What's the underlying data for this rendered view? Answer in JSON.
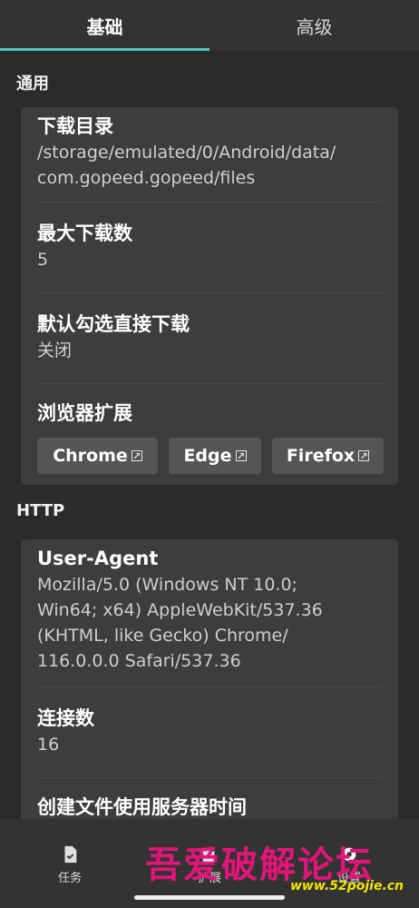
{
  "tabs": [
    {
      "label": "基础",
      "active": true
    },
    {
      "label": "高级",
      "active": false
    }
  ],
  "general": {
    "section_title": "通用",
    "download_dir": {
      "title": "下载目录",
      "value": "/storage/emulated/0/Android/data/\ncom.gopeed.gopeed/files"
    },
    "max_downloads": {
      "title": "最大下载数",
      "value": "5"
    },
    "default_select": {
      "title": "默认勾选直接下载",
      "value": "关闭"
    },
    "browser_ext": {
      "title": "浏览器扩展",
      "buttons": [
        {
          "label": "Chrome",
          "icon": "open-external-icon"
        },
        {
          "label": "Edge",
          "icon": "open-external-icon"
        },
        {
          "label": "Firefox",
          "icon": "open-external-icon"
        }
      ]
    }
  },
  "http": {
    "section_title": "HTTP",
    "user_agent": {
      "title": "User-Agent",
      "value": "Mozilla/5.0 (Windows NT 10.0;\nWin64; x64) AppleWebKit/537.36\n(KHTML, like Gecko) Chrome/\n116.0.0.0 Safari/537.36"
    },
    "connections": {
      "title": "连接数",
      "value": "16"
    },
    "server_time": {
      "title": "创建文件使用服务器时间"
    }
  },
  "bottom_nav": [
    {
      "label": "任务",
      "icon": "task-icon"
    },
    {
      "label": "扩展",
      "icon": "extension-icon"
    },
    {
      "label": "设置",
      "icon": "settings-icon"
    }
  ],
  "watermark": {
    "text": "吾爱破解论坛",
    "url": "www.52pojie.cn"
  },
  "colors": {
    "accent": "#52c7be",
    "background": "#2b2b2b",
    "card": "#3d3d3d"
  }
}
